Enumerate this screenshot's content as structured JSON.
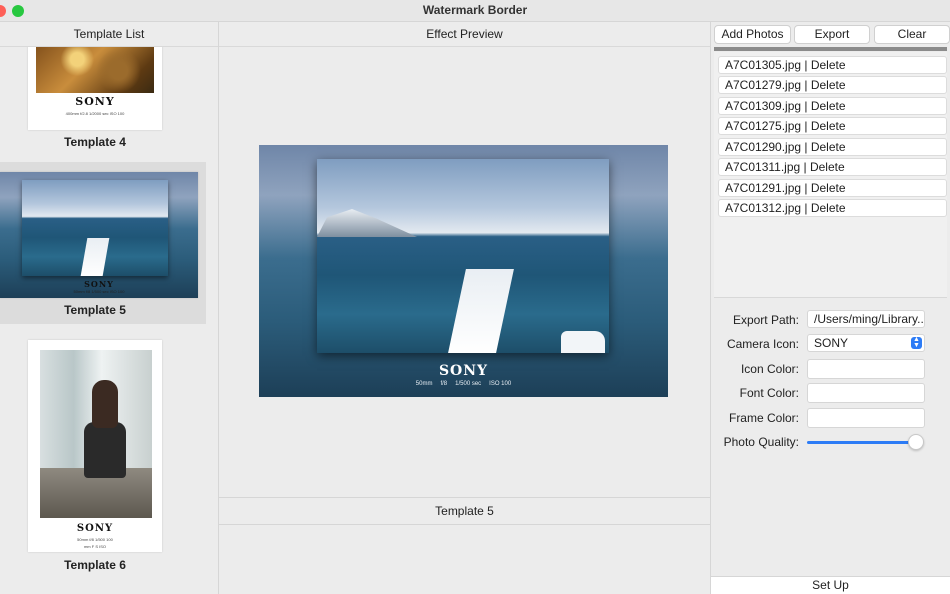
{
  "window": {
    "title": "Watermark Border"
  },
  "left": {
    "header": "Template List",
    "templates": [
      {
        "name": "Template 4",
        "brand": "SONY",
        "meta": "400mm f/2.8 1/2000 sec ISO 100"
      },
      {
        "name": "Template 5",
        "brand": "SONY",
        "meta": "50mm f/8 1/500 sec ISO 100",
        "selected": true
      },
      {
        "name": "Template 6",
        "brand": "SONY",
        "meta": [
          "50mm",
          "f/8",
          "1/500",
          "100",
          "mm",
          "F",
          "S",
          "ISO"
        ]
      }
    ]
  },
  "middle": {
    "header": "Effect Preview",
    "preview": {
      "brand": "SONY",
      "meta": [
        "50mm",
        "f/8",
        "1/500 sec",
        "ISO 100"
      ]
    },
    "current_template": "Template 5"
  },
  "right": {
    "buttons": {
      "add": "Add Photos",
      "export": "Export",
      "clear": "Clear"
    },
    "files": [
      "A7C01305.jpg | Delete",
      "A7C01279.jpg | Delete",
      "A7C01309.jpg | Delete",
      "A7C01275.jpg | Delete",
      "A7C01290.jpg | Delete",
      "A7C01311.jpg | Delete",
      "A7C01291.jpg | Delete",
      "A7C01312.jpg | Delete"
    ],
    "form": {
      "export_path_label": "Export Path:",
      "export_path_value": "/Users/ming/Library...",
      "camera_icon_label": "Camera Icon:",
      "camera_icon_value": "SONY",
      "icon_color_label": "Icon Color:",
      "font_color_label": "Font Color:",
      "frame_color_label": "Frame Color:",
      "photo_quality_label": "Photo Quality:",
      "photo_quality": 0.95
    },
    "setup": "Set Up"
  },
  "colors": {
    "accent": "#2d7cf6",
    "close": "#fe5f57",
    "zoom": "#28c840"
  }
}
